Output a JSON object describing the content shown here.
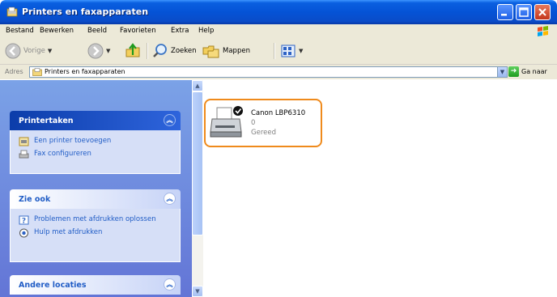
{
  "window": {
    "title": "Printers en faxapparaten"
  },
  "menu": [
    "Bestand",
    "Bewerken",
    "Beeld",
    "Favorieten",
    "Extra",
    "Help"
  ],
  "toolbar": {
    "back": "Vorige",
    "search": "Zoeken",
    "folders": "Mappen"
  },
  "address": {
    "label": "Adres",
    "value": "Printers en faxapparaten",
    "go": "Ga naar"
  },
  "taskpane": {
    "groups": [
      {
        "title": "Printertaken",
        "tasks": [
          "Een printer toevoegen",
          "Fax configureren"
        ]
      },
      {
        "title": "Zie ook",
        "tasks": [
          "Problemen met afdrukken oplossen",
          "Hulp met afdrukken"
        ]
      },
      {
        "title": "Andere locaties"
      }
    ]
  },
  "printer": {
    "name": "Canon LBP6310",
    "count": "0",
    "status": "Gereed"
  },
  "colors": {
    "titlebar": "#0553d6",
    "highlight": "#ef8a1c",
    "taskpane": "#7ba2e7",
    "link": "#215dc6"
  }
}
